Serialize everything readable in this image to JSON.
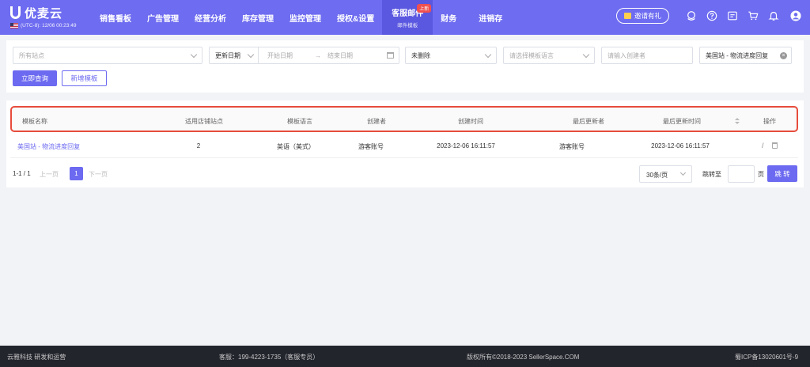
{
  "brand": {
    "name": "优麦云",
    "timezone": "(UTC-8): 12/06 00:23:49"
  },
  "nav": {
    "items": [
      {
        "label": "销售看板"
      },
      {
        "label": "广告管理"
      },
      {
        "label": "经营分析"
      },
      {
        "label": "库存管理"
      },
      {
        "label": "监控管理"
      },
      {
        "label": "授权&设置"
      },
      {
        "label": "客服邮件",
        "sub": "邮件模板",
        "badge": "上新",
        "active": true
      },
      {
        "label": "财务"
      },
      {
        "label": "进销存"
      }
    ],
    "invite_label": "邀请有礼"
  },
  "filters": {
    "site_placeholder": "所有站点",
    "date_type": "更新日期",
    "start_placeholder": "开始日期",
    "end_placeholder": "结束日期",
    "delete_status": "未删除",
    "language_placeholder": "请选择模板语言",
    "creator_placeholder": "请输入创建者",
    "template_value": "美国站 - 物流进度回复",
    "query_button": "立即查询",
    "add_button": "新增模板"
  },
  "table": {
    "columns": [
      "模板名称",
      "适用店铺站点",
      "模板语言",
      "创建者",
      "创建时间",
      "最后更新者",
      "最后更新时间",
      "操作"
    ],
    "rows": [
      {
        "name": "美国站 - 物流进度回复",
        "stores": "2",
        "language": "英语（美式）",
        "creator": "游客账号",
        "created_at": "2023-12-06 16:11:57",
        "updater": "游客账号",
        "updated_at": "2023-12-06 16:11:57"
      }
    ]
  },
  "pagination": {
    "info": "1-1 / 1",
    "prev": "上一页",
    "current": "1",
    "next": "下一页",
    "page_size": "30条/页",
    "goto_label": "跳转至",
    "page_label": "页",
    "jump_button": "跳 转"
  },
  "footer": {
    "company": "云雅科技 研发和运营",
    "service": "客服：199-4223-1735（客服专员）",
    "copyright": "版权所有©2018-2023 SellerSpace.COM",
    "icp": "蜀ICP备13020601号-9"
  }
}
